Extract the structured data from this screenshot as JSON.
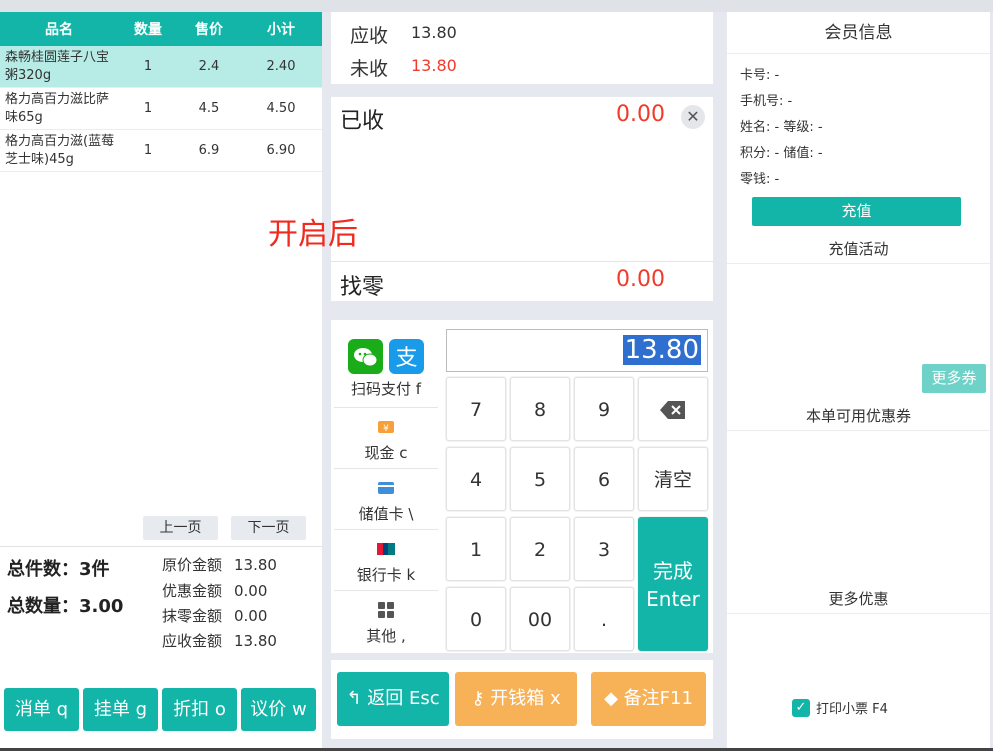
{
  "cart": {
    "headers": [
      "品名",
      "数量",
      "售价",
      "小计"
    ],
    "rows": [
      {
        "name": "森畅桂圆莲子八宝粥320g",
        "qty": "1",
        "price": "2.4",
        "subtotal": "2.40"
      },
      {
        "name": "格力高百力滋比萨味65g",
        "qty": "1",
        "price": "4.5",
        "subtotal": "4.50"
      },
      {
        "name": "格力高百力滋(蓝莓芝士味)45g",
        "qty": "1",
        "price": "6.9",
        "subtotal": "6.90"
      }
    ],
    "prev_page": "上一页",
    "next_page": "下一页"
  },
  "summary": {
    "total_items_label": "总件数：",
    "total_items_value": "3件",
    "total_qty_label": "总数量：",
    "total_qty_value": "3.00",
    "original_label": "原价金额",
    "original_value": "13.80",
    "discount_label": "优惠金额",
    "discount_value": "0.00",
    "rounding_label": "抹零金额",
    "rounding_value": "0.00",
    "due_label": "应收金额",
    "due_value": "13.80"
  },
  "actions": {
    "cancel": "消单 q",
    "hold": "挂单 g",
    "discount": "折扣 o",
    "bargain": "议价 w"
  },
  "payment": {
    "receivable_label": "应收",
    "receivable_value": "13.80",
    "unpaid_label": "未收",
    "unpaid_value": "13.80",
    "paid_label": "已收",
    "paid_value": "0.00",
    "change_label": "找零",
    "change_value": "0.00",
    "input_value": "13.80"
  },
  "pay_methods": {
    "scan": "扫码支付 f",
    "cash": "现金 c",
    "stored_card": "储值卡 \\",
    "bank_card": "银行卡 k",
    "other": "其他 ,"
  },
  "keypad": {
    "k7": "7",
    "k8": "8",
    "k9": "9",
    "k4": "4",
    "k5": "5",
    "k6": "6",
    "k1": "1",
    "k2": "2",
    "k3": "3",
    "k0": "0",
    "k00": "00",
    "kdot": ".",
    "clear": "清空",
    "done_line1": "完成",
    "done_line2": "Enter"
  },
  "bottom_actions": {
    "back": "返回 Esc",
    "cash_box": "开钱箱 x",
    "note": "备注F11"
  },
  "member": {
    "title": "会员信息",
    "card_no": "卡号: -",
    "phone": "手机号: -",
    "name_level": "姓名: -  等级: -",
    "points_balance": "积分: -  储值: -",
    "change": "零钱: -",
    "recharge": "充值",
    "recharge_activity": "充值活动",
    "more_coupons": "更多券",
    "available_coupons": "本单可用优惠券",
    "more_offers": "更多优惠",
    "print_receipt": "打印小票 F4"
  },
  "overlay_text": "开启后",
  "colors": {
    "teal": "#12b5a8",
    "orange": "#f7b156",
    "red": "#f13a2b"
  }
}
